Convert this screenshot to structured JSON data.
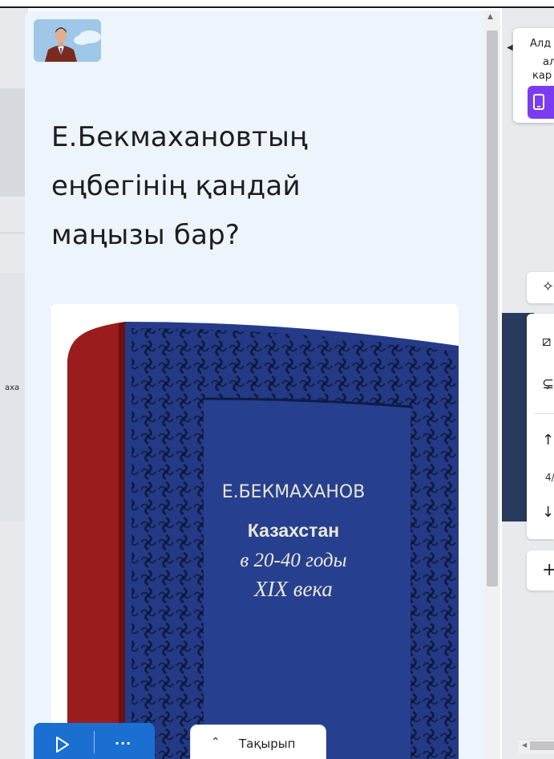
{
  "panel": {
    "title_lines": [
      "Е.Бекмахановтың",
      "еңбегінің қандай",
      "маңызы бар?"
    ],
    "book": {
      "author": "Е.БЕКМАХАНОВ",
      "title_line1": "Казахстан",
      "title_line2": "в 20-40 годы",
      "title_line3": "XIX века"
    }
  },
  "left_background": {
    "clipped_text": "аха"
  },
  "right_popup": {
    "lines": [
      "Алд",
      "ал",
      "кар"
    ]
  },
  "right_toolbar": {
    "page_counter": "4/"
  },
  "bottom_bar": {
    "more_label": "...",
    "topic_label": "Тақырып"
  },
  "colors": {
    "accent": "#1a6fd1",
    "purple": "#7b3cf0",
    "panel_bg": "#edf4fc",
    "book_blue": "#263c8c",
    "book_red": "#9b1c1c"
  }
}
